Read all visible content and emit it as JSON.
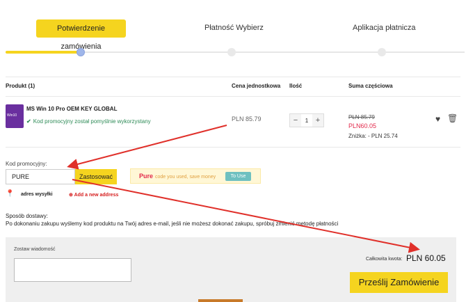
{
  "steps": {
    "step1": "Potwierdzenie zamówienia",
    "step2": "Płatność Wybierz",
    "step3": "Aplikacja płatnicza"
  },
  "table_header": {
    "product": "Produkt (1)",
    "unit_price": "Cena jednostkowa",
    "quantity": "Ilość",
    "subtotal": "Suma częściowa"
  },
  "product": {
    "thumb_text": "Win10",
    "name": "MS Win 10 Pro OEM KEY GLOBAL",
    "promo_status": "Kod promocyjny został pomyślnie wykorzystany",
    "unit_price": "PLN 85.79",
    "quantity": "1",
    "qty_minus": "−",
    "qty_plus": "+",
    "old_price": "PLN 85.79",
    "new_price": "PLN60.05",
    "discount": "Zniżka: - PLN 25.74"
  },
  "promo": {
    "label": "Kod promocyjny:",
    "code": "PURE",
    "apply_label": "Zastosować",
    "hint_code": "Pure",
    "hint_text": "code you used, save money",
    "to_use": "To Use"
  },
  "address": {
    "label": "adres wysyłki",
    "add_label": "Add a new address"
  },
  "shipping": {
    "title": "Sposób dostawy:",
    "text": "Po dokonaniu zakupu wyślemy kod produktu na Twój adres e-mail, jeśli nie możesz dokonać zakupu, spróbuj zmienić metodę płatności"
  },
  "bottom": {
    "message_label": "Zostaw wiadomość",
    "total_label": "Całkowita kwota:",
    "total_value": "PLN 60.05",
    "submit_label": "Prześlij Zamówienie"
  },
  "colors": {
    "accent": "#f5d41f",
    "price_red": "#e2284a",
    "success_green": "#2e8b57",
    "arrow_red": "#e0302a"
  },
  "icons": [
    "check-icon",
    "heart-icon",
    "trash-icon",
    "map-pin-icon",
    "plus-circle-icon"
  ]
}
